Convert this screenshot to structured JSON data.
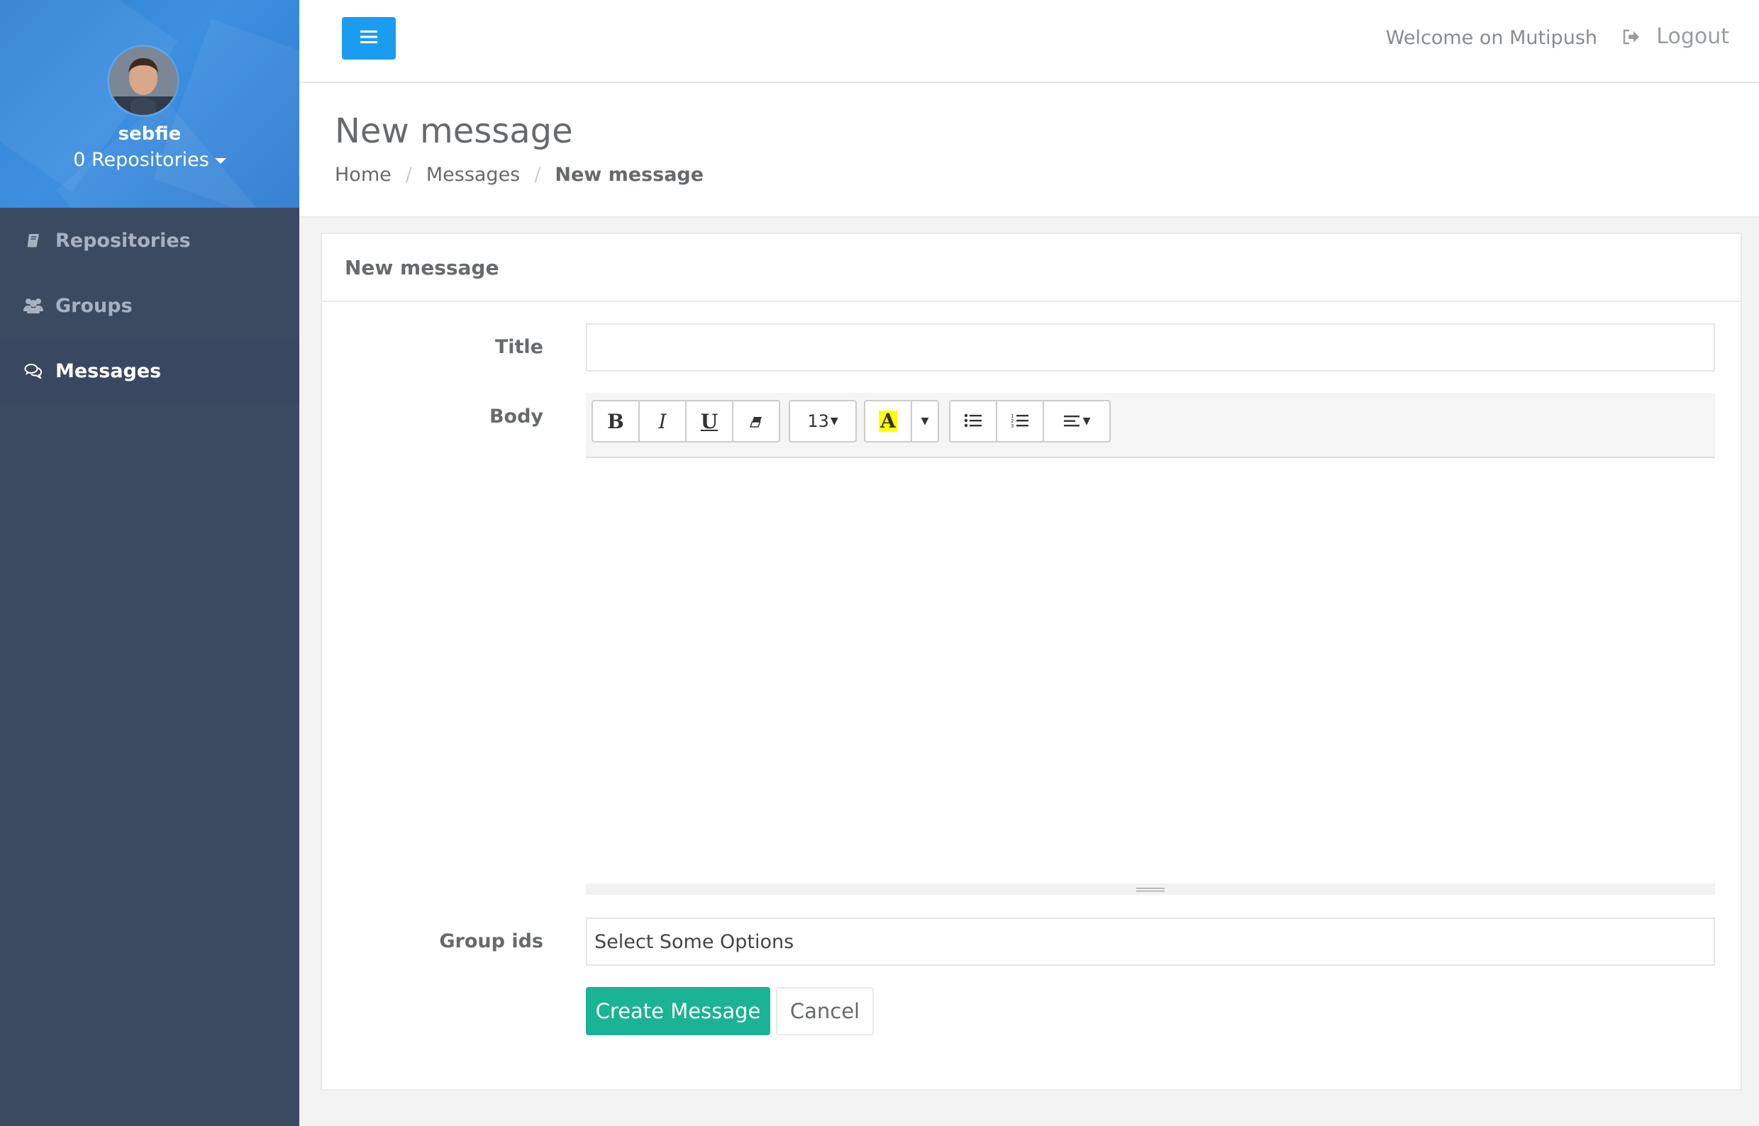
{
  "sidebar": {
    "profile": {
      "name": "sebfie",
      "repositories_label": "0 Repositories"
    },
    "items": [
      {
        "label": "Repositories",
        "icon": "book-icon"
      },
      {
        "label": "Groups",
        "icon": "users-icon"
      },
      {
        "label": "Messages",
        "icon": "comments-icon",
        "active": true
      }
    ]
  },
  "topbar": {
    "welcome": "Welcome on Mutipush",
    "logout_label": "Logout"
  },
  "heading": {
    "title": "New message",
    "breadcrumb": [
      "Home",
      "Messages",
      "New message"
    ]
  },
  "panel": {
    "title": "New message",
    "title_label": "Title",
    "title_value": "",
    "body_label": "Body",
    "font_size": "13",
    "group_ids_label": "Group ids",
    "group_ids_placeholder": "Select Some Options",
    "create_label": "Create Message",
    "cancel_label": "Cancel"
  },
  "colors": {
    "sidebar_bg": "#3c4a61",
    "profile_bg": "#2f80d2",
    "primary_btn": "#1c9cf0",
    "success_btn": "#1ab394",
    "highlight": "#ffff00"
  }
}
